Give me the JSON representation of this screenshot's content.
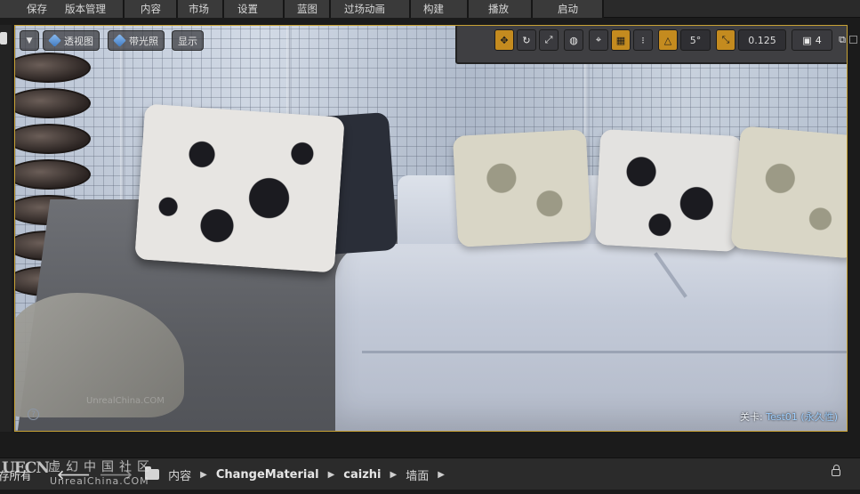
{
  "toolbar": {
    "save": "保存",
    "source_control": "版本管理",
    "content": "内容",
    "marketplace": "市场",
    "settings": "设置",
    "blueprints": "蓝图",
    "cinematics": "过场动画",
    "build": "构建",
    "play": "播放",
    "launch": "启动"
  },
  "viewport": {
    "perspective": "透视图",
    "lit": "带光照",
    "show": "显示",
    "rotation_snap": "5°",
    "scale_snap": "0.125",
    "camera_speed": "4",
    "level_label": "关卡:",
    "level_name": "Test01 (永久性)",
    "faint_watermark": "UnrealChina.COM",
    "help_glyph": "?",
    "icons": {
      "translate": "translate-icon",
      "rotate": "rotate-icon",
      "scale": "scale-icon",
      "world": "world-icon",
      "surface_snap": "surface-snap-icon",
      "grid": "grid-snap-icon",
      "rotate_snap": "rotate-snap-icon",
      "scale_snap": "scale-snap-icon",
      "camera": "camera-speed-icon",
      "maximize": "maximize-icon"
    }
  },
  "content_browser": {
    "save_all": "存所有",
    "path": [
      "内容",
      "ChangeMaterial",
      "caizhi",
      "墙面"
    ]
  },
  "watermark": {
    "logo": "UECN",
    "chinese": "虚幻中国社区",
    "english": "UnrealChina.COM"
  },
  "colors": {
    "accent": "#c48b1f",
    "viewport_border": "#c8a235"
  }
}
